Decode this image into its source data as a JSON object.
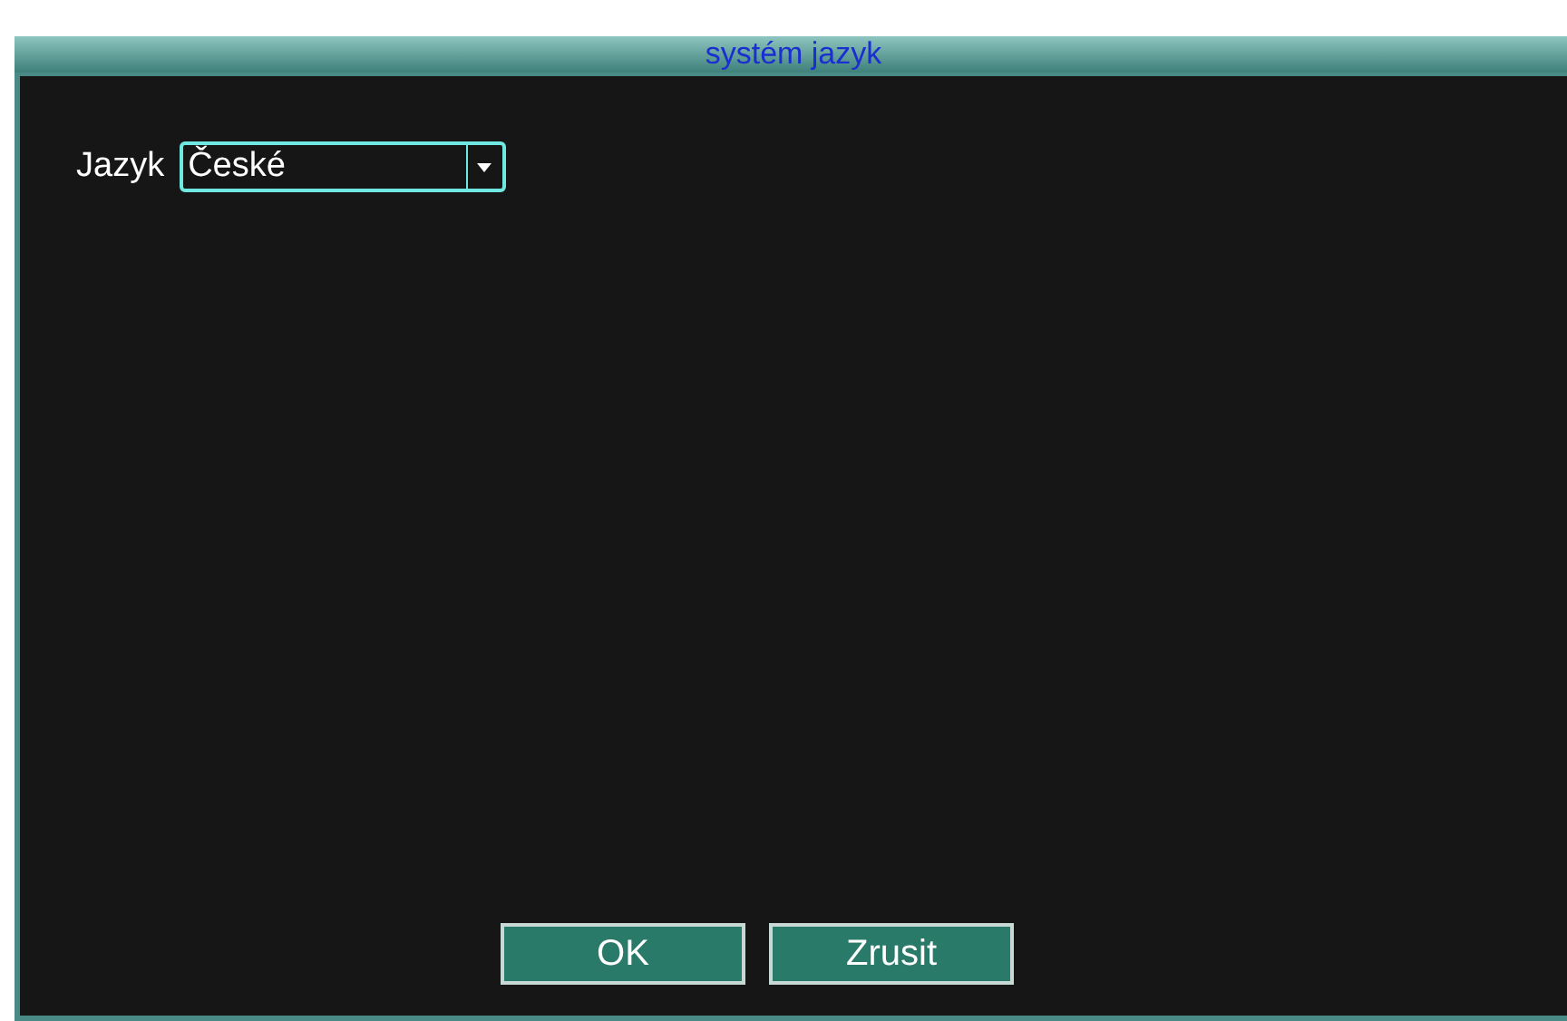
{
  "window": {
    "title": "systém jazyk"
  },
  "language": {
    "label": "Jazyk",
    "value": "České"
  },
  "buttons": [
    {
      "label": "OK"
    },
    {
      "label": "Zrusit"
    }
  ]
}
